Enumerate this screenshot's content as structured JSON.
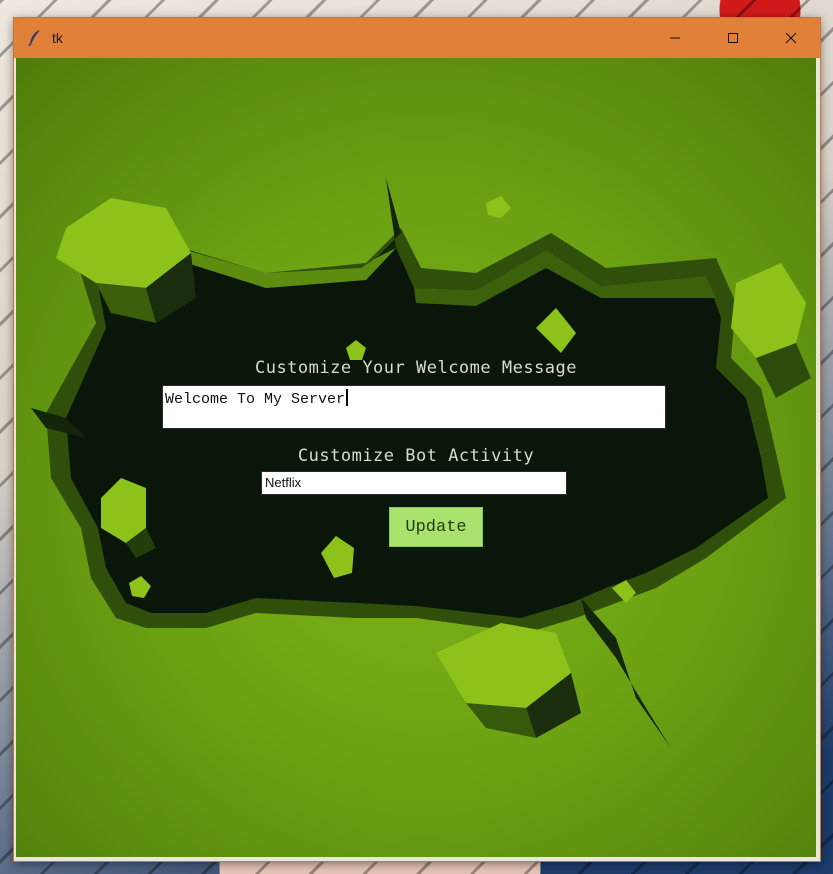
{
  "window": {
    "title": "tk",
    "minimize_icon": "minimize-icon",
    "maximize_icon": "maximize-icon",
    "close_icon": "close-icon",
    "titlebar_color": "#e08039"
  },
  "form": {
    "welcome_label": "Customize Your Welcome Message",
    "welcome_value": "Welcome To My Server",
    "activity_label": "Customize Bot Activity",
    "activity_value": "Netflix",
    "update_label": "Update"
  },
  "colors": {
    "background_green": "#6da313",
    "hole_dark": "#0b160a",
    "button_green": "#a9e36d",
    "label_text": "#d7dccb"
  }
}
